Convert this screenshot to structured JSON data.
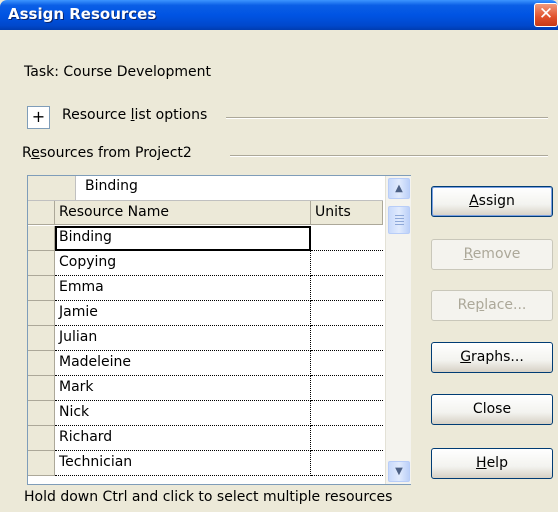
{
  "dialog": {
    "title": "Assign Resources",
    "close_glyph": "✕",
    "task_label": "Task: Course Development",
    "resource_list_toggle": "+",
    "resource_list_options_pre": "Resource ",
    "resource_list_options_u": "l",
    "resource_list_options_post": "ist options",
    "resources_from_pre": "R",
    "resources_from_u": "e",
    "resources_from_post": "sources from Project2",
    "footer_text": "Hold down Ctrl and click to select multiple resources"
  },
  "grid": {
    "edit_value": "Binding",
    "columns": [
      "Resource Name",
      "Units"
    ],
    "rows": [
      {
        "name": "Binding",
        "units": ""
      },
      {
        "name": "Copying",
        "units": ""
      },
      {
        "name": "Emma",
        "units": ""
      },
      {
        "name": "Jamie",
        "units": ""
      },
      {
        "name": "Julian",
        "units": ""
      },
      {
        "name": "Madeleine",
        "units": ""
      },
      {
        "name": "Mark",
        "units": ""
      },
      {
        "name": "Nick",
        "units": ""
      },
      {
        "name": "Richard",
        "units": ""
      },
      {
        "name": "Technician",
        "units": ""
      }
    ],
    "scroll_up_glyph": "▲",
    "scroll_down_glyph": "▼"
  },
  "buttons": {
    "assign": {
      "pre": "",
      "u": "A",
      "post": "ssign"
    },
    "remove": {
      "pre": "",
      "u": "R",
      "post": "emove"
    },
    "replace": {
      "pre": "Re",
      "u": "p",
      "post": "lace..."
    },
    "graphs": {
      "pre": "",
      "u": "G",
      "post": "raphs..."
    },
    "close": {
      "label": "Close"
    },
    "help": {
      "pre": "",
      "u": "H",
      "post": "elp"
    }
  }
}
